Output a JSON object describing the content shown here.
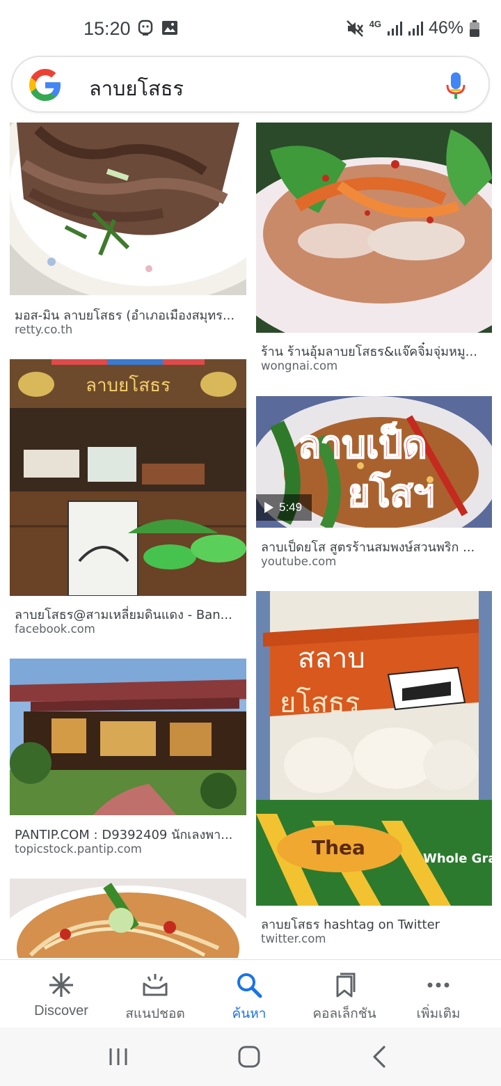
{
  "status_bar": {
    "time": "15:20",
    "battery": "46%",
    "network": "4G",
    "icons": [
      "face-icon",
      "image-icon",
      "mute-icon",
      "signal-icon",
      "signal-icon-2",
      "battery-icon"
    ]
  },
  "search": {
    "query": "ลาบยโสธร",
    "icons": [
      "google-logo",
      "mic-icon"
    ]
  },
  "results": [
    {
      "title": "มอส-มิน ลาบยโสธร (อำเภอเมืองสมุทร...",
      "source": "retty.co.th"
    },
    {
      "title": "ร้าน ร้านอุ้มลาบยโสธร&แจ๊คจิ๋มจุ่มหมู...",
      "source": "wongnai.com"
    },
    {
      "title": "ลาบยโสธร@สามเหลี่ยมดินแดง - Ban...",
      "source": "facebook.com"
    },
    {
      "title": "ลาบเป็ดยโส สูตรร้านสมพงษ์สวนพริก ...",
      "source": "youtube.com",
      "video_duration": "5:49",
      "overlay_text": [
        "ลาบเป็ด",
        "ยโสฯ"
      ]
    },
    {
      "title": "PANTIP.COM : D9392409 นักเลงพา...",
      "source": "topicstock.pantip.com"
    },
    {
      "title": "ลาบยโสธร hashtag on Twitter",
      "source": "twitter.com",
      "overlay_text": [
        "สลาบ",
        "ยโสธร"
      ]
    },
    {
      "title": "",
      "source": ""
    }
  ],
  "bottom_nav": [
    {
      "label": "Discover",
      "icon": "asterisk-icon",
      "active": false
    },
    {
      "label": "สแนปชอต",
      "icon": "snapshot-icon",
      "active": false
    },
    {
      "label": "ค้นหา",
      "icon": "search-icon",
      "active": true
    },
    {
      "label": "คอลเล็กชัน",
      "icon": "bookmark-icon",
      "active": false
    },
    {
      "label": "เพิ่มเติม",
      "icon": "more-icon",
      "active": false
    }
  ],
  "system_nav": [
    "recents-icon",
    "home-icon",
    "back-icon"
  ],
  "colors": {
    "accent": "#1a73e8",
    "text": "#3c4043",
    "muted": "#5f6368"
  }
}
